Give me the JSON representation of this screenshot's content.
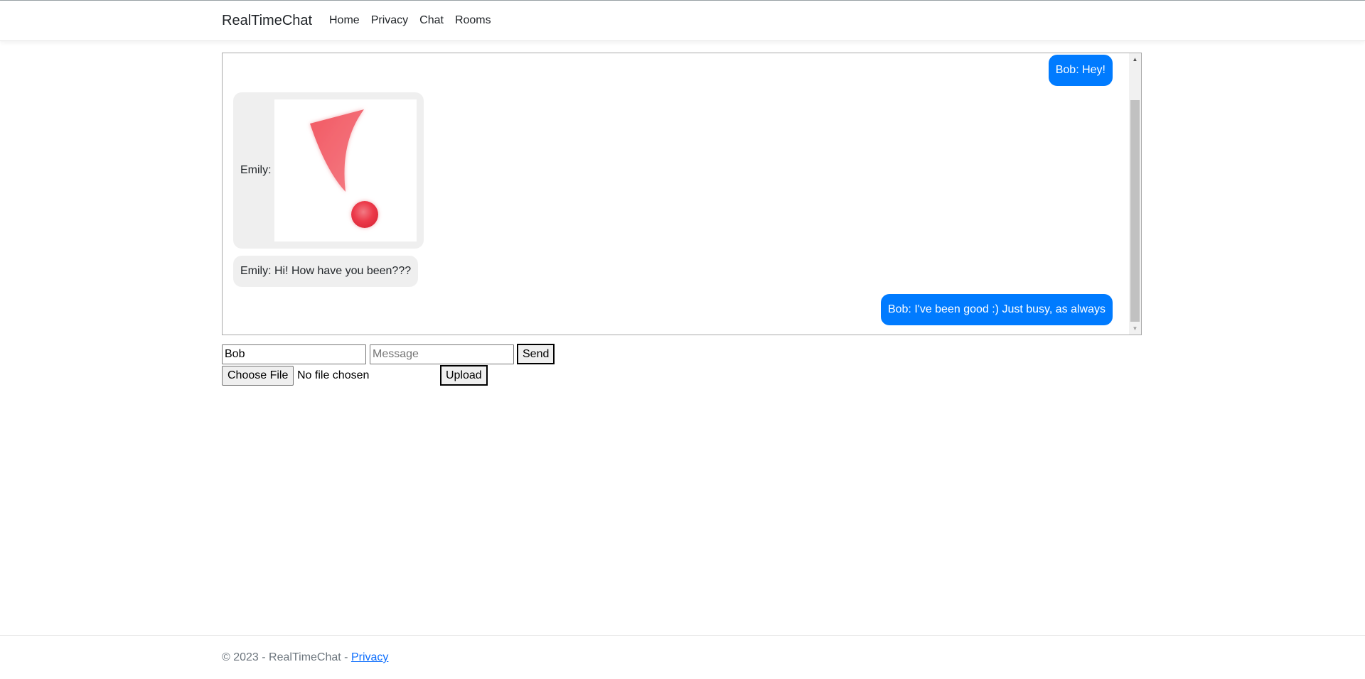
{
  "navbar": {
    "brand": "RealTimeChat",
    "links": [
      "Home",
      "Privacy",
      "Chat",
      "Rooms"
    ]
  },
  "chat": {
    "messages": [
      {
        "text": "Bob: Hey!",
        "side": "right"
      },
      {
        "sender": "Emily:",
        "type": "image",
        "image_icon": "exclamation-mark-icon",
        "side": "left"
      },
      {
        "text": "Emily: Hi! How have you been???",
        "side": "left"
      },
      {
        "text": "Bob: I've been good :) Just busy, as always",
        "side": "right"
      }
    ]
  },
  "form": {
    "name_value": "Bob",
    "message_placeholder": "Message",
    "send_label": "Send",
    "choose_file_label": "Choose File",
    "file_status": "No file chosen",
    "upload_label": "Upload"
  },
  "footer": {
    "text": "© 2023 - RealTimeChat - ",
    "link": "Privacy"
  },
  "colors": {
    "own_bubble": "#007bff",
    "other_bubble": "#efefef",
    "link": "#0d6efd"
  }
}
